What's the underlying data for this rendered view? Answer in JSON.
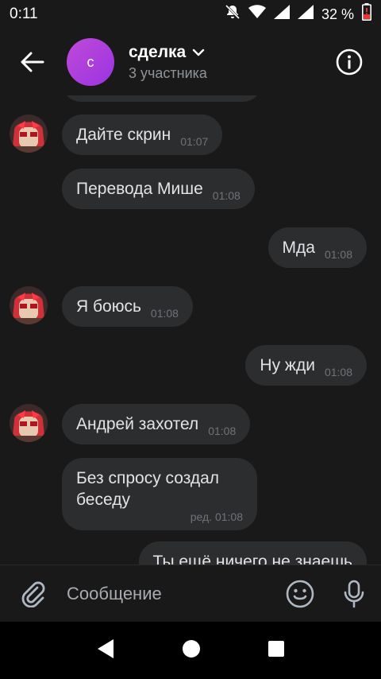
{
  "status_bar": {
    "time": "0:11",
    "battery": "32 %"
  },
  "header": {
    "avatar_letter": "с",
    "title": "сделка",
    "subtitle": "3 участника"
  },
  "messages": [
    {
      "dir": "in",
      "avatar": true,
      "text": "Дайте скрин",
      "time": "01:07"
    },
    {
      "dir": "in",
      "avatar": false,
      "text": "Перевода Мише",
      "time": "01:08"
    },
    {
      "dir": "out",
      "text": "Мда",
      "time": "01:08"
    },
    {
      "dir": "in",
      "avatar": true,
      "text": "Я боюсь",
      "time": "01:08"
    },
    {
      "dir": "out",
      "text": "Ну жди",
      "time": "01:08"
    },
    {
      "dir": "in",
      "avatar": true,
      "text": "Андрей захотел",
      "time": "01:08"
    },
    {
      "dir": "in",
      "avatar": false,
      "text": "Без спросу создал беседу",
      "time": "ред. 01:08"
    },
    {
      "dir": "out",
      "text": "Ты ещё ничего не знаешь",
      "time": ""
    }
  ],
  "composer": {
    "placeholder": "Сообщение"
  }
}
